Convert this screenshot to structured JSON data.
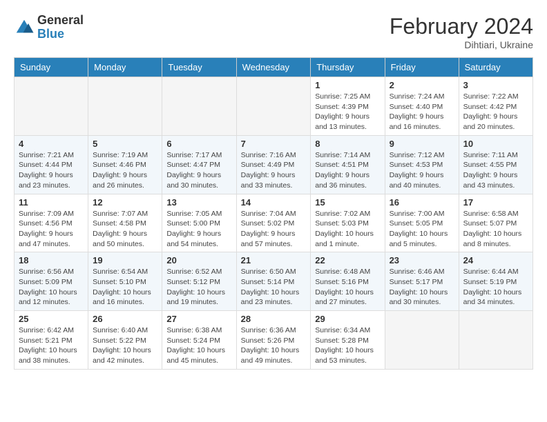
{
  "header": {
    "logo_general": "General",
    "logo_blue": "Blue",
    "month_year": "February 2024",
    "location": "Dihtiari, Ukraine"
  },
  "days_of_week": [
    "Sunday",
    "Monday",
    "Tuesday",
    "Wednesday",
    "Thursday",
    "Friday",
    "Saturday"
  ],
  "weeks": [
    [
      {
        "day": null,
        "info": null
      },
      {
        "day": null,
        "info": null
      },
      {
        "day": null,
        "info": null
      },
      {
        "day": null,
        "info": null
      },
      {
        "day": "1",
        "info": "Sunrise: 7:25 AM\nSunset: 4:39 PM\nDaylight: 9 hours\nand 13 minutes."
      },
      {
        "day": "2",
        "info": "Sunrise: 7:24 AM\nSunset: 4:40 PM\nDaylight: 9 hours\nand 16 minutes."
      },
      {
        "day": "3",
        "info": "Sunrise: 7:22 AM\nSunset: 4:42 PM\nDaylight: 9 hours\nand 20 minutes."
      }
    ],
    [
      {
        "day": "4",
        "info": "Sunrise: 7:21 AM\nSunset: 4:44 PM\nDaylight: 9 hours\nand 23 minutes."
      },
      {
        "day": "5",
        "info": "Sunrise: 7:19 AM\nSunset: 4:46 PM\nDaylight: 9 hours\nand 26 minutes."
      },
      {
        "day": "6",
        "info": "Sunrise: 7:17 AM\nSunset: 4:47 PM\nDaylight: 9 hours\nand 30 minutes."
      },
      {
        "day": "7",
        "info": "Sunrise: 7:16 AM\nSunset: 4:49 PM\nDaylight: 9 hours\nand 33 minutes."
      },
      {
        "day": "8",
        "info": "Sunrise: 7:14 AM\nSunset: 4:51 PM\nDaylight: 9 hours\nand 36 minutes."
      },
      {
        "day": "9",
        "info": "Sunrise: 7:12 AM\nSunset: 4:53 PM\nDaylight: 9 hours\nand 40 minutes."
      },
      {
        "day": "10",
        "info": "Sunrise: 7:11 AM\nSunset: 4:55 PM\nDaylight: 9 hours\nand 43 minutes."
      }
    ],
    [
      {
        "day": "11",
        "info": "Sunrise: 7:09 AM\nSunset: 4:56 PM\nDaylight: 9 hours\nand 47 minutes."
      },
      {
        "day": "12",
        "info": "Sunrise: 7:07 AM\nSunset: 4:58 PM\nDaylight: 9 hours\nand 50 minutes."
      },
      {
        "day": "13",
        "info": "Sunrise: 7:05 AM\nSunset: 5:00 PM\nDaylight: 9 hours\nand 54 minutes."
      },
      {
        "day": "14",
        "info": "Sunrise: 7:04 AM\nSunset: 5:02 PM\nDaylight: 9 hours\nand 57 minutes."
      },
      {
        "day": "15",
        "info": "Sunrise: 7:02 AM\nSunset: 5:03 PM\nDaylight: 10 hours\nand 1 minute."
      },
      {
        "day": "16",
        "info": "Sunrise: 7:00 AM\nSunset: 5:05 PM\nDaylight: 10 hours\nand 5 minutes."
      },
      {
        "day": "17",
        "info": "Sunrise: 6:58 AM\nSunset: 5:07 PM\nDaylight: 10 hours\nand 8 minutes."
      }
    ],
    [
      {
        "day": "18",
        "info": "Sunrise: 6:56 AM\nSunset: 5:09 PM\nDaylight: 10 hours\nand 12 minutes."
      },
      {
        "day": "19",
        "info": "Sunrise: 6:54 AM\nSunset: 5:10 PM\nDaylight: 10 hours\nand 16 minutes."
      },
      {
        "day": "20",
        "info": "Sunrise: 6:52 AM\nSunset: 5:12 PM\nDaylight: 10 hours\nand 19 minutes."
      },
      {
        "day": "21",
        "info": "Sunrise: 6:50 AM\nSunset: 5:14 PM\nDaylight: 10 hours\nand 23 minutes."
      },
      {
        "day": "22",
        "info": "Sunrise: 6:48 AM\nSunset: 5:16 PM\nDaylight: 10 hours\nand 27 minutes."
      },
      {
        "day": "23",
        "info": "Sunrise: 6:46 AM\nSunset: 5:17 PM\nDaylight: 10 hours\nand 30 minutes."
      },
      {
        "day": "24",
        "info": "Sunrise: 6:44 AM\nSunset: 5:19 PM\nDaylight: 10 hours\nand 34 minutes."
      }
    ],
    [
      {
        "day": "25",
        "info": "Sunrise: 6:42 AM\nSunset: 5:21 PM\nDaylight: 10 hours\nand 38 minutes."
      },
      {
        "day": "26",
        "info": "Sunrise: 6:40 AM\nSunset: 5:22 PM\nDaylight: 10 hours\nand 42 minutes."
      },
      {
        "day": "27",
        "info": "Sunrise: 6:38 AM\nSunset: 5:24 PM\nDaylight: 10 hours\nand 45 minutes."
      },
      {
        "day": "28",
        "info": "Sunrise: 6:36 AM\nSunset: 5:26 PM\nDaylight: 10 hours\nand 49 minutes."
      },
      {
        "day": "29",
        "info": "Sunrise: 6:34 AM\nSunset: 5:28 PM\nDaylight: 10 hours\nand 53 minutes."
      },
      {
        "day": null,
        "info": null
      },
      {
        "day": null,
        "info": null
      }
    ]
  ]
}
